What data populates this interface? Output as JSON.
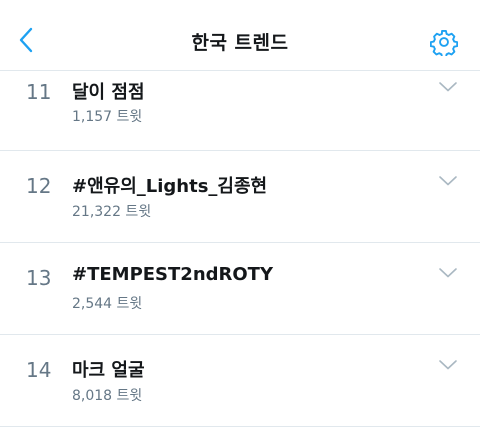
{
  "header": {
    "title": "한국 트렌드",
    "back_icon": "chevron-left-icon",
    "settings_icon": "gear-icon",
    "accent_color": "#1da1f2"
  },
  "trends": [
    {
      "rank": "11",
      "name": "달이 점점",
      "count": "1,157 트윗"
    },
    {
      "rank": "12",
      "name": "#앤유의_Lights_김종현",
      "count": "21,322 트윗"
    },
    {
      "rank": "13",
      "name": "#TEMPEST2ndROTY",
      "count": "2,544 트윗"
    },
    {
      "rank": "14",
      "name": "마크 얼굴",
      "count": "8,018 트윗"
    }
  ],
  "colors": {
    "text_primary": "#14171a",
    "text_secondary": "#657786",
    "divider": "#e1e8ed",
    "chevron": "#aab8c2"
  }
}
